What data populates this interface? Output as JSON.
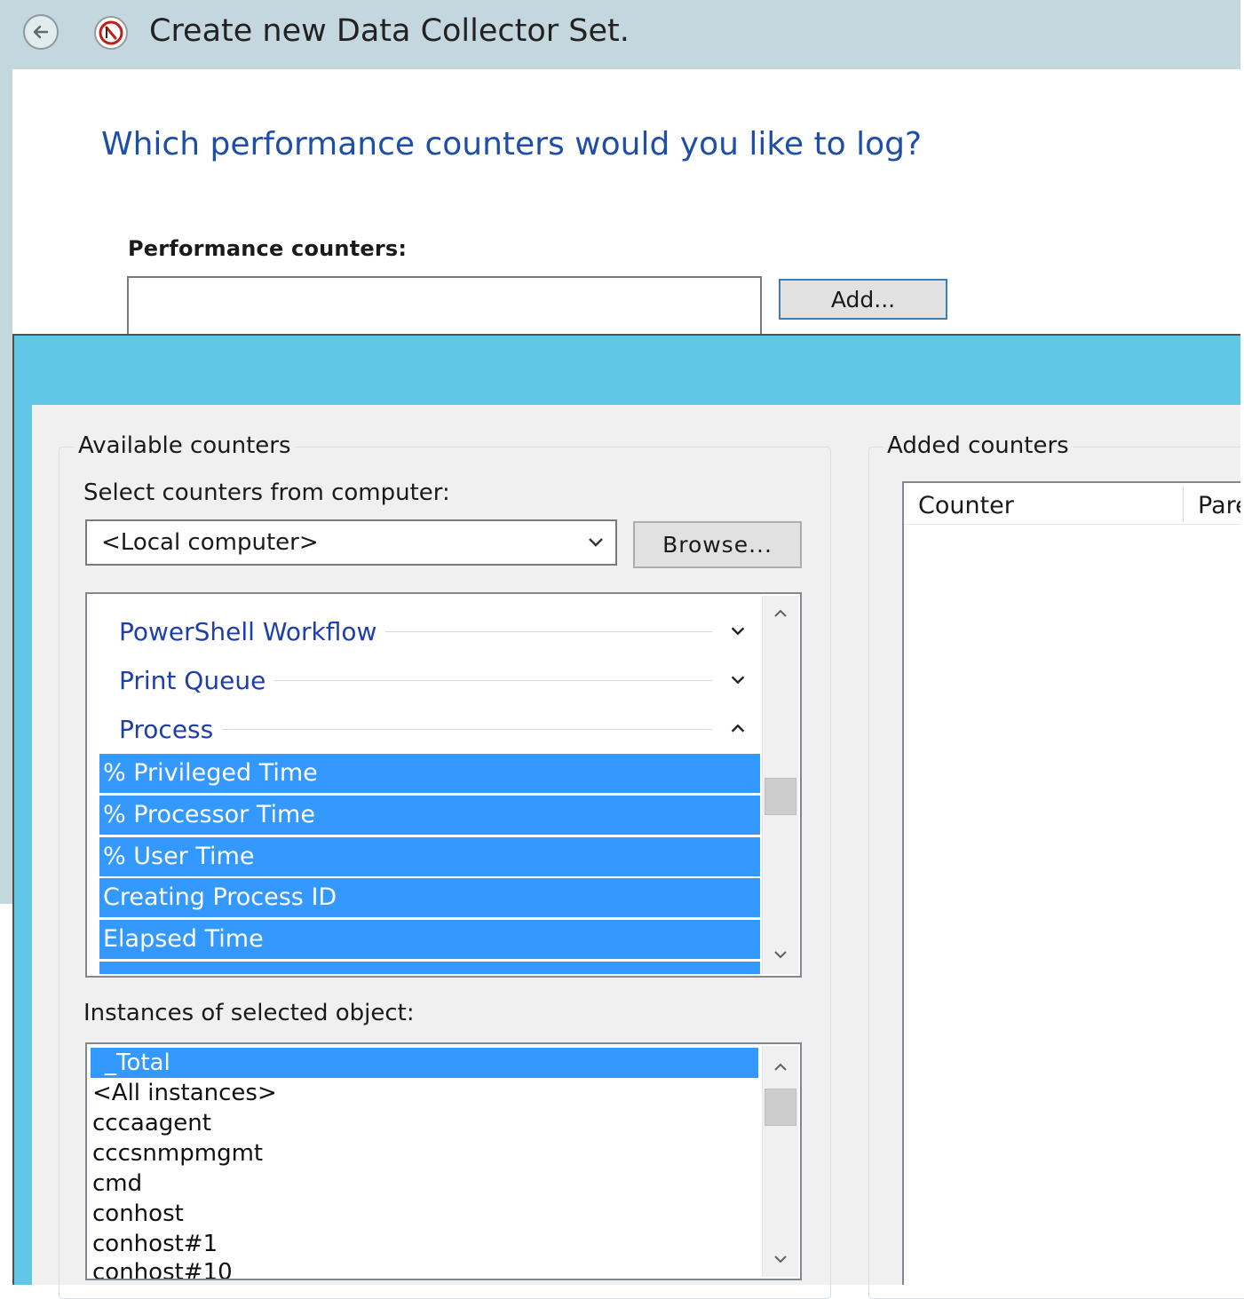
{
  "wizard": {
    "title": "Create new Data Collector Set.",
    "heading": "Which performance counters would you like to log?",
    "performance_counters_label": "Performance counters:",
    "performance_counters_value": "",
    "add_button": "Add..."
  },
  "dialog": {
    "available_counters_title": "Available counters",
    "select_from_label": "Select counters from computer:",
    "computer_value": "<Local computer>",
    "browse_button": "Browse...",
    "categories": [
      {
        "label": "PowerShell Workflow",
        "expanded": false
      },
      {
        "label": "Print Queue",
        "expanded": false
      },
      {
        "label": "Process",
        "expanded": true
      }
    ],
    "process_counters": [
      "% Privileged Time",
      "% Processor Time",
      "% User Time",
      "Creating Process ID",
      "Elapsed Time"
    ],
    "instances_label": "Instances of selected object:",
    "instances": [
      "_Total",
      "<All instances>",
      "cccaagent",
      "cccsnmpmgmt",
      "cmd",
      "conhost",
      "conhost#1",
      "conhost#10"
    ],
    "added_counters_title": "Added counters",
    "added_columns": [
      "Counter",
      "Pare"
    ]
  },
  "colors": {
    "selection": "#3399ff",
    "dialog_titlebar": "#62c6e6",
    "heading_blue": "#1e4fa8",
    "category_blue": "#1e3fa8"
  },
  "icons": {
    "back": "back-arrow-icon",
    "app": "performance-monitor-icon",
    "dropdown": "chevron-down-icon",
    "collapse": "chevron-up-icon"
  }
}
